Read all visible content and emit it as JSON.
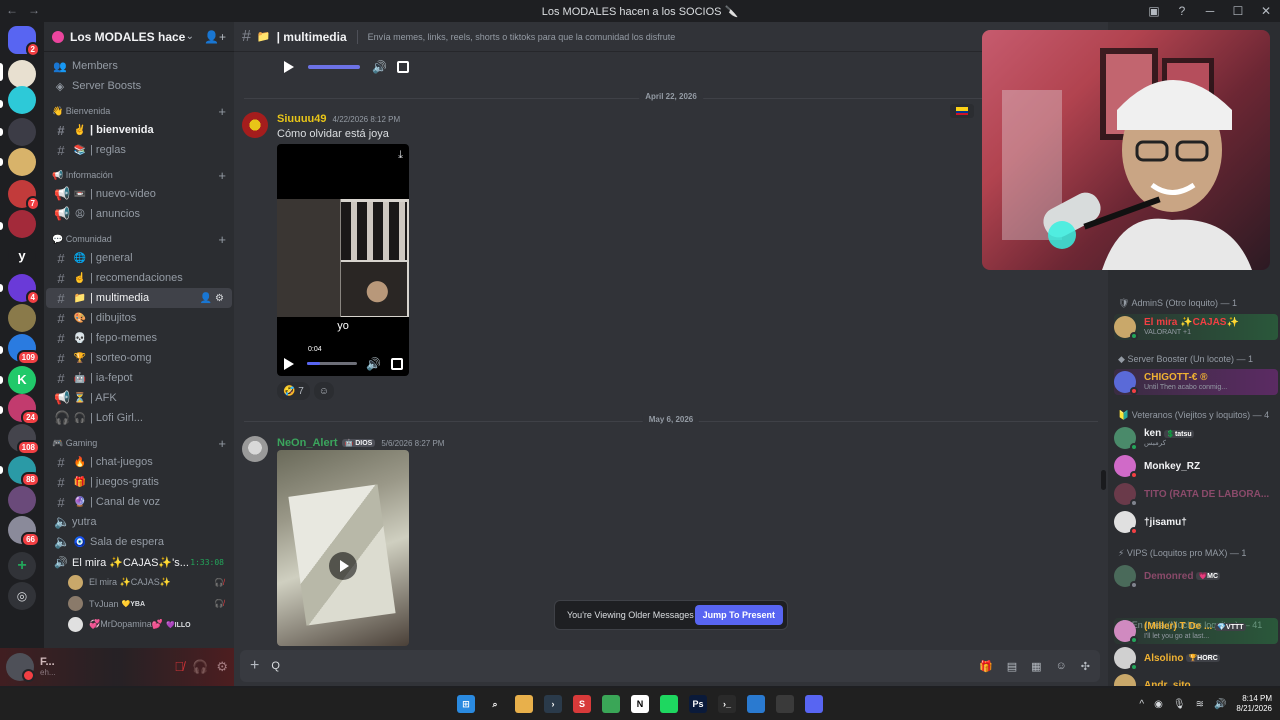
{
  "window": {
    "title": "Los MODALES hacen a los SOCIOS",
    "title_emoji": "🔪",
    "controls": [
      "─",
      "☐",
      "✕"
    ]
  },
  "rail": {
    "servers": [
      {
        "name": "direct-messages",
        "color": "#5865f2",
        "badge": "2",
        "letter": ""
      },
      {
        "name": "server-1",
        "color": "#e8e0d0",
        "badge": "",
        "letter": ""
      },
      {
        "name": "server-2",
        "color": "#2dc9d8",
        "badge": "",
        "letter": ""
      },
      {
        "name": "server-3",
        "color": "#3c3c46",
        "badge": "",
        "letter": ""
      },
      {
        "name": "server-4",
        "color": "#d8b36a",
        "badge": "",
        "letter": ""
      },
      {
        "name": "server-5",
        "color": "#c23b3b",
        "badge": "7",
        "letter": ""
      },
      {
        "name": "server-6",
        "color": "#a32a3a",
        "badge": "",
        "letter": ""
      },
      {
        "name": "server-y",
        "color": "#1e1f22",
        "badge": "",
        "letter": "y"
      },
      {
        "name": "server-8",
        "color": "#6a3ad8",
        "badge": "4",
        "letter": ""
      },
      {
        "name": "server-9",
        "color": "#8a7a4a",
        "badge": "",
        "letter": ""
      },
      {
        "name": "server-10",
        "color": "#2a7be0",
        "badge": "109",
        "letter": ""
      },
      {
        "name": "server-11",
        "color": "#21c96a",
        "badge": "",
        "letter": "K"
      },
      {
        "name": "server-12",
        "color": "#c23b6e",
        "badge": "24",
        "letter": ""
      },
      {
        "name": "server-13",
        "color": "#44444c",
        "badge": "108",
        "letter": ""
      },
      {
        "name": "server-14",
        "color": "#2a9aa6",
        "badge": "88",
        "letter": ""
      },
      {
        "name": "server-15",
        "color": "#6a4a7a",
        "badge": "",
        "letter": ""
      },
      {
        "name": "server-16",
        "color": "#8a8a9a",
        "badge": "66",
        "letter": ""
      }
    ]
  },
  "server": {
    "name": "Los MODALES hacen a l...",
    "top_items": [
      {
        "label": "Members"
      },
      {
        "label": "Server Boosts"
      }
    ],
    "categories": [
      {
        "name": "Bienvenida",
        "emoji": "👋",
        "channels": [
          {
            "label": "| bienvenida",
            "emoji": "✌️",
            "state": "unread"
          },
          {
            "label": "| reglas",
            "emoji": "📚",
            "state": ""
          }
        ]
      },
      {
        "name": "Información",
        "emoji": "📢",
        "channels": [
          {
            "label": "| nuevo-video",
            "emoji": "📼",
            "state": ""
          },
          {
            "label": "| anuncios",
            "emoji": "😩",
            "state": ""
          }
        ]
      },
      {
        "name": "Comunidad",
        "emoji": "💬",
        "channels": [
          {
            "label": "| general",
            "emoji": "🌐",
            "state": ""
          },
          {
            "label": "| recomendaciones",
            "emoji": "☝️",
            "state": ""
          },
          {
            "label": "| multimedia",
            "emoji": "📁",
            "state": "active"
          },
          {
            "label": "| dibujitos",
            "emoji": "🎨",
            "state": ""
          },
          {
            "label": "| fepo-memes",
            "emoji": "💀",
            "state": ""
          },
          {
            "label": "| sorteo-omg",
            "emoji": "🏆",
            "state": ""
          },
          {
            "label": "| ia-fepot",
            "emoji": "🤖",
            "state": ""
          },
          {
            "label": "| AFK",
            "emoji": "⏳",
            "state": ""
          },
          {
            "label": "| Lofi Girl...",
            "emoji": "🎧",
            "state": ""
          }
        ]
      },
      {
        "name": "Gaming",
        "emoji": "🎮",
        "channels": [
          {
            "label": "| chat-juegos",
            "emoji": "🔥",
            "state": ""
          },
          {
            "label": "| juegos-gratis",
            "emoji": "🎁",
            "state": ""
          },
          {
            "label": "| Canal de voz",
            "emoji": "🔮",
            "state": ""
          }
        ]
      }
    ],
    "extra_channels": [
      {
        "label": "yutra"
      },
      {
        "label": "Sala de espera",
        "emoji": "🧿"
      }
    ],
    "voice": {
      "label": "El mira ✨CAJAS✨'s...",
      "timer": "1:33:08",
      "users": [
        {
          "name": "El mira ✨CAJAS✨",
          "tag": "",
          "color": "#c9a86a"
        },
        {
          "name": "TvJuan",
          "tag": "💛YBA",
          "color": "#8a7a6a"
        },
        {
          "name": "💞MrDopamina💕",
          "tag": "💜ILLO",
          "color": "#e0e0e0"
        }
      ]
    }
  },
  "user_panel": {
    "name": "F...",
    "status": "eh..."
  },
  "channel": {
    "name": "| multimedia",
    "topic": "Envía memes, links, reels, shorts o tiktoks para que la comunidad los disfrute"
  },
  "messages": {
    "divider1": "April 22, 2026",
    "divider2": "May 6, 2026",
    "msg1": {
      "author": "Siuuuu49",
      "author_color": "#e8c518",
      "time": "4/22/2026 8:12 PM",
      "text": "Cómo olvidar está joya",
      "video_caption": "yo",
      "video_time": "0:04",
      "reaction_emoji": "🤣",
      "reaction_count": "7"
    },
    "msg2": {
      "author": "NeOn_Alert",
      "author_color": "#3ba55d",
      "role": "🤖 DIOS",
      "time": "5/6/2026 8:27 PM"
    }
  },
  "older_banner": {
    "text": "You're Viewing Older Messages",
    "button": "Jump To Present"
  },
  "composer": {
    "value": "Q"
  },
  "members": {
    "groups": [
      {
        "label": "AdminS (Otro loquito) — 1"
      },
      {
        "label": "Server Booster (Un locote) — 1"
      },
      {
        "label": "Veteranos (Viejitos y loquitos) — 4"
      },
      {
        "label": "VIPS (Loquitos pro MAX) — 1"
      },
      {
        "label": "En línea (Muchos loquitos) — 41"
      }
    ],
    "list": [
      {
        "name": "El mira ✨CAJAS✨",
        "activity": "VALORANT +1",
        "color": "#f23f43",
        "tag": "",
        "status": "#23a55a",
        "avatar": "#c9a86a",
        "style": "valo"
      },
      {
        "name": "CHIGOTT-€ ®",
        "activity": "Until Then acabo conmig...",
        "color": "#f0b232",
        "tag": "",
        "status": "#f23f43",
        "avatar": "#5a6ad8",
        "style": "boosted"
      },
      {
        "name": "ken",
        "activity": "كرمبس",
        "color": "#f2f3f5",
        "tag": "💲tatsu",
        "status": "#23a55a",
        "avatar": "#4a8a6a",
        "style": ""
      },
      {
        "name": "Monkey_RZ",
        "activity": "",
        "color": "#f2f3f5",
        "tag": "",
        "status": "#f23f43",
        "avatar": "#d06ac8",
        "style": ""
      },
      {
        "name": "TITO (RATA DE LABORA...",
        "activity": "",
        "color": "#8a4a6a",
        "tag": "",
        "status": "#80848e",
        "avatar": "#6a3a4a",
        "style": ""
      },
      {
        "name": "†jisamu†",
        "activity": "",
        "color": "#f2f3f5",
        "tag": "",
        "status": "#f23f43",
        "avatar": "#e0e0e0",
        "style": ""
      },
      {
        "name": "Demonred",
        "activity": "",
        "color": "#8a4a6a",
        "tag": "💗MC",
        "status": "#80848e",
        "avatar": "#4a6a5a",
        "style": ""
      },
      {
        "name": "(Miller) T De ...",
        "activity": "I'll let you go at last...",
        "color": "#f0b232",
        "tag": "💎VTTT",
        "status": "#23a55a",
        "avatar": "#d08ac0",
        "style": "valo"
      },
      {
        "name": "Alsolino",
        "activity": "",
        "color": "#f0b232",
        "tag": "🏆HORC",
        "status": "#23a55a",
        "avatar": "#d0d0d0",
        "style": ""
      },
      {
        "name": "Andr_sito",
        "activity": "",
        "color": "#f0b232",
        "tag": "",
        "status": "#23a55a",
        "avatar": "#c9a86a",
        "style": ""
      }
    ]
  },
  "taskbar": {
    "time": "8:14 PM",
    "date": "8/21/2026",
    "apps": [
      {
        "name": "start",
        "color": "#2a8ae0",
        "label": "⊞"
      },
      {
        "name": "search",
        "color": "transparent",
        "label": "⌕"
      },
      {
        "name": "explorer",
        "color": "#e8b04b",
        "label": ""
      },
      {
        "name": "terminal",
        "color": "#2a3a4a",
        "label": "›"
      },
      {
        "name": "app-red",
        "color": "#d83a3a",
        "label": "S"
      },
      {
        "name": "chrome",
        "color": "#3aa657",
        "label": ""
      },
      {
        "name": "notion",
        "color": "#ffffff",
        "label": "N"
      },
      {
        "name": "spotify",
        "color": "#1ed760",
        "label": ""
      },
      {
        "name": "photoshop",
        "color": "#0a1a3a",
        "label": "Ps"
      },
      {
        "name": "code",
        "color": "#2a2a2a",
        "label": "›_"
      },
      {
        "name": "vscode",
        "color": "#2a7ad0",
        "label": ""
      },
      {
        "name": "obs",
        "color": "#3a3a3a",
        "label": ""
      },
      {
        "name": "discord",
        "color": "#5865f2",
        "label": ""
      }
    ]
  }
}
